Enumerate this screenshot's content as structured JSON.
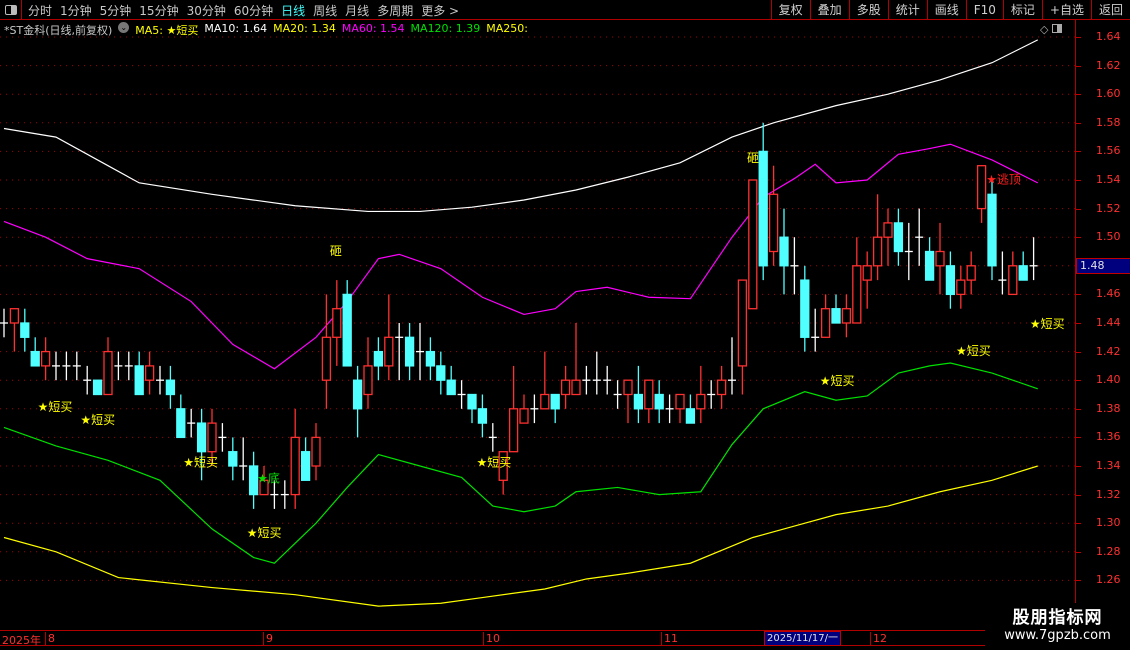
{
  "toolbar": {
    "periods": [
      "分时",
      "1分钟",
      "5分钟",
      "15分钟",
      "30分钟",
      "60分钟",
      "日线",
      "周线",
      "月线",
      "多周期",
      "更多 >"
    ],
    "active_period": "日线",
    "buttons": [
      "复权",
      "叠加",
      "多股",
      "统计",
      "画线",
      "F10",
      "标记",
      "+自选",
      "返回"
    ]
  },
  "info": {
    "stock": "*ST金科(日线,前复权)",
    "ma5_label": "MA5:",
    "ma5_value": "★短买",
    "ma10": "MA10: 1.64",
    "ma20": "MA20: 1.34",
    "ma60": "MA60: 1.54",
    "ma120": "MA120: 1.39",
    "ma250": "MA250:"
  },
  "colors": {
    "up": "#ff3030",
    "down": "#50ffff",
    "doji": "#ffffff",
    "ma_white": "#ffffff",
    "ma_magenta": "#ff00ff",
    "ma_green": "#00e000",
    "ma_yellow": "#ffff00",
    "grid": "#a00000"
  },
  "price_axis": {
    "labels": [
      "1.64",
      "1.62",
      "1.60",
      "1.58",
      "1.56",
      "1.54",
      "1.52",
      "1.50",
      "1.48",
      "1.46",
      "1.44",
      "1.42",
      "1.40",
      "1.38",
      "1.36",
      "1.34",
      "1.32",
      "1.30",
      "1.28",
      "1.26"
    ],
    "current": "1.48"
  },
  "date_axis": {
    "labels": [
      "2025年",
      "8",
      "9",
      "10",
      "11",
      "12"
    ],
    "cursor": "2025/11/17/一"
  },
  "watermark": {
    "line1": "股朋指标网",
    "line2": "www.7gpzb.com"
  },
  "chart_data": {
    "type": "candlestick",
    "ylim": [
      1.25,
      1.65
    ],
    "candles_ohlc": [
      [
        1.44,
        1.44,
        1.45,
        1.43
      ],
      [
        1.44,
        1.45,
        1.45,
        1.42
      ],
      [
        1.44,
        1.43,
        1.45,
        1.42
      ],
      [
        1.42,
        1.41,
        1.43,
        1.41
      ],
      [
        1.41,
        1.42,
        1.43,
        1.4
      ],
      [
        1.41,
        1.41,
        1.42,
        1.4
      ],
      [
        1.41,
        1.41,
        1.42,
        1.4
      ],
      [
        1.41,
        1.41,
        1.42,
        1.4
      ],
      [
        1.4,
        1.4,
        1.41,
        1.39
      ],
      [
        1.4,
        1.39,
        1.4,
        1.39
      ],
      [
        1.39,
        1.42,
        1.43,
        1.39
      ],
      [
        1.41,
        1.41,
        1.42,
        1.4
      ],
      [
        1.41,
        1.41,
        1.42,
        1.4
      ],
      [
        1.41,
        1.39,
        1.42,
        1.39
      ],
      [
        1.4,
        1.41,
        1.42,
        1.39
      ],
      [
        1.4,
        1.4,
        1.41,
        1.39
      ],
      [
        1.4,
        1.39,
        1.41,
        1.38
      ],
      [
        1.38,
        1.36,
        1.39,
        1.36
      ],
      [
        1.37,
        1.37,
        1.38,
        1.36
      ],
      [
        1.37,
        1.35,
        1.38,
        1.33
      ],
      [
        1.35,
        1.37,
        1.38,
        1.34
      ],
      [
        1.36,
        1.36,
        1.37,
        1.35
      ],
      [
        1.35,
        1.34,
        1.36,
        1.33
      ],
      [
        1.34,
        1.34,
        1.36,
        1.33
      ],
      [
        1.34,
        1.32,
        1.35,
        1.31
      ],
      [
        1.32,
        1.33,
        1.34,
        1.32
      ],
      [
        1.32,
        1.32,
        1.33,
        1.31
      ],
      [
        1.32,
        1.32,
        1.33,
        1.31
      ],
      [
        1.32,
        1.36,
        1.38,
        1.31
      ],
      [
        1.35,
        1.33,
        1.36,
        1.33
      ],
      [
        1.34,
        1.36,
        1.37,
        1.33
      ],
      [
        1.4,
        1.43,
        1.46,
        1.38
      ],
      [
        1.43,
        1.45,
        1.47,
        1.41
      ],
      [
        1.46,
        1.41,
        1.47,
        1.41
      ],
      [
        1.4,
        1.38,
        1.41,
        1.36
      ],
      [
        1.39,
        1.41,
        1.43,
        1.38
      ],
      [
        1.42,
        1.41,
        1.43,
        1.4
      ],
      [
        1.41,
        1.43,
        1.46,
        1.4
      ],
      [
        1.43,
        1.43,
        1.44,
        1.4
      ],
      [
        1.43,
        1.41,
        1.44,
        1.4
      ],
      [
        1.42,
        1.42,
        1.44,
        1.4
      ],
      [
        1.42,
        1.41,
        1.43,
        1.4
      ],
      [
        1.41,
        1.4,
        1.42,
        1.39
      ],
      [
        1.4,
        1.39,
        1.41,
        1.39
      ],
      [
        1.39,
        1.39,
        1.4,
        1.38
      ],
      [
        1.39,
        1.38,
        1.39,
        1.37
      ],
      [
        1.38,
        1.37,
        1.39,
        1.36
      ],
      [
        1.36,
        1.36,
        1.37,
        1.35
      ],
      [
        1.33,
        1.35,
        1.35,
        1.32
      ],
      [
        1.35,
        1.38,
        1.41,
        1.35
      ],
      [
        1.37,
        1.38,
        1.39,
        1.37
      ],
      [
        1.38,
        1.38,
        1.39,
        1.37
      ],
      [
        1.38,
        1.39,
        1.42,
        1.38
      ],
      [
        1.39,
        1.38,
        1.39,
        1.37
      ],
      [
        1.39,
        1.4,
        1.41,
        1.38
      ],
      [
        1.39,
        1.4,
        1.44,
        1.39
      ],
      [
        1.4,
        1.4,
        1.41,
        1.39
      ],
      [
        1.4,
        1.4,
        1.42,
        1.39
      ],
      [
        1.4,
        1.4,
        1.41,
        1.39
      ],
      [
        1.39,
        1.39,
        1.4,
        1.38
      ],
      [
        1.39,
        1.4,
        1.4,
        1.37
      ],
      [
        1.39,
        1.38,
        1.41,
        1.37
      ],
      [
        1.38,
        1.4,
        1.4,
        1.37
      ],
      [
        1.39,
        1.38,
        1.4,
        1.37
      ],
      [
        1.38,
        1.38,
        1.39,
        1.37
      ],
      [
        1.38,
        1.39,
        1.39,
        1.37
      ],
      [
        1.38,
        1.37,
        1.39,
        1.37
      ],
      [
        1.38,
        1.39,
        1.41,
        1.37
      ],
      [
        1.39,
        1.39,
        1.4,
        1.38
      ],
      [
        1.39,
        1.4,
        1.41,
        1.38
      ],
      [
        1.4,
        1.4,
        1.43,
        1.39
      ],
      [
        1.41,
        1.47,
        1.47,
        1.39
      ],
      [
        1.45,
        1.54,
        1.54,
        1.45
      ],
      [
        1.56,
        1.48,
        1.58,
        1.47
      ],
      [
        1.49,
        1.53,
        1.55,
        1.48
      ],
      [
        1.5,
        1.48,
        1.52,
        1.46
      ],
      [
        1.48,
        1.48,
        1.5,
        1.46
      ],
      [
        1.47,
        1.43,
        1.48,
        1.42
      ],
      [
        1.43,
        1.43,
        1.45,
        1.42
      ],
      [
        1.43,
        1.45,
        1.46,
        1.43
      ],
      [
        1.45,
        1.44,
        1.46,
        1.44
      ],
      [
        1.44,
        1.45,
        1.46,
        1.43
      ],
      [
        1.44,
        1.48,
        1.5,
        1.44
      ],
      [
        1.47,
        1.48,
        1.49,
        1.45
      ],
      [
        1.48,
        1.5,
        1.53,
        1.47
      ],
      [
        1.5,
        1.51,
        1.52,
        1.48
      ],
      [
        1.51,
        1.49,
        1.52,
        1.48
      ],
      [
        1.49,
        1.49,
        1.51,
        1.47
      ],
      [
        1.5,
        1.5,
        1.52,
        1.48
      ],
      [
        1.49,
        1.47,
        1.5,
        1.47
      ],
      [
        1.48,
        1.49,
        1.51,
        1.46
      ],
      [
        1.48,
        1.46,
        1.49,
        1.45
      ],
      [
        1.46,
        1.47,
        1.48,
        1.45
      ],
      [
        1.47,
        1.48,
        1.49,
        1.46
      ],
      [
        1.52,
        1.55,
        1.55,
        1.51
      ],
      [
        1.53,
        1.48,
        1.54,
        1.47
      ],
      [
        1.47,
        1.47,
        1.49,
        1.46
      ],
      [
        1.46,
        1.48,
        1.49,
        1.46
      ],
      [
        1.48,
        1.47,
        1.49,
        1.47
      ],
      [
        1.48,
        1.48,
        1.5,
        1.47
      ]
    ],
    "lines": [
      {
        "name": "white",
        "points": [
          [
            0,
            1.576
          ],
          [
            5,
            1.57
          ],
          [
            10,
            1.55
          ],
          [
            13,
            1.538
          ],
          [
            20,
            1.53
          ],
          [
            28,
            1.522
          ],
          [
            35,
            1.518
          ],
          [
            40,
            1.518
          ],
          [
            45,
            1.521
          ],
          [
            50,
            1.526
          ],
          [
            55,
            1.533
          ],
          [
            60,
            1.542
          ],
          [
            65,
            1.552
          ],
          [
            70,
            1.57
          ],
          [
            74,
            1.58
          ],
          [
            80,
            1.592
          ],
          [
            85,
            1.6
          ],
          [
            90,
            1.61
          ],
          [
            95,
            1.622
          ],
          [
            99.4,
            1.638
          ]
        ]
      },
      {
        "name": "magenta",
        "points": [
          [
            0,
            1.511
          ],
          [
            4,
            1.5
          ],
          [
            8,
            1.485
          ],
          [
            13,
            1.478
          ],
          [
            18,
            1.455
          ],
          [
            22,
            1.425
          ],
          [
            26,
            1.408
          ],
          [
            30,
            1.43
          ],
          [
            33,
            1.455
          ],
          [
            36,
            1.485
          ],
          [
            38,
            1.488
          ],
          [
            42,
            1.478
          ],
          [
            46,
            1.458
          ],
          [
            50,
            1.446
          ],
          [
            53,
            1.45
          ],
          [
            55,
            1.462
          ],
          [
            58,
            1.465
          ],
          [
            62,
            1.458
          ],
          [
            66,
            1.457
          ],
          [
            70,
            1.5
          ],
          [
            73,
            1.528
          ],
          [
            76,
            1.541
          ],
          [
            78,
            1.551
          ],
          [
            80,
            1.538
          ],
          [
            83,
            1.54
          ],
          [
            86,
            1.558
          ],
          [
            89,
            1.562
          ],
          [
            91,
            1.565
          ],
          [
            95,
            1.554
          ],
          [
            99.4,
            1.538
          ]
        ]
      },
      {
        "name": "green",
        "points": [
          [
            0,
            1.367
          ],
          [
            5,
            1.354
          ],
          [
            10,
            1.344
          ],
          [
            15,
            1.33
          ],
          [
            20,
            1.296
          ],
          [
            24,
            1.276
          ],
          [
            26,
            1.272
          ],
          [
            30,
            1.3
          ],
          [
            33,
            1.325
          ],
          [
            36,
            1.348
          ],
          [
            40,
            1.34
          ],
          [
            44,
            1.332
          ],
          [
            47,
            1.312
          ],
          [
            50,
            1.308
          ],
          [
            53,
            1.312
          ],
          [
            55,
            1.322
          ],
          [
            59,
            1.325
          ],
          [
            63,
            1.32
          ],
          [
            67,
            1.322
          ],
          [
            70,
            1.355
          ],
          [
            73,
            1.38
          ],
          [
            77,
            1.392
          ],
          [
            80,
            1.386
          ],
          [
            83,
            1.389
          ],
          [
            86,
            1.405
          ],
          [
            89,
            1.41
          ],
          [
            91,
            1.412
          ],
          [
            95,
            1.405
          ],
          [
            99.4,
            1.394
          ]
        ]
      },
      {
        "name": "yellow",
        "points": [
          [
            0,
            1.29
          ],
          [
            5,
            1.28
          ],
          [
            11,
            1.262
          ],
          [
            20,
            1.255
          ],
          [
            28,
            1.25
          ],
          [
            36,
            1.242
          ],
          [
            42,
            1.244
          ],
          [
            46,
            1.248
          ],
          [
            52,
            1.254
          ],
          [
            56,
            1.261
          ],
          [
            60,
            1.265
          ],
          [
            66,
            1.272
          ],
          [
            72,
            1.29
          ],
          [
            76,
            1.298
          ],
          [
            80,
            1.306
          ],
          [
            85,
            1.312
          ],
          [
            90,
            1.322
          ],
          [
            95,
            1.33
          ],
          [
            99.4,
            1.34
          ]
        ]
      }
    ],
    "signals": [
      {
        "label": "★短买",
        "kind": "buy",
        "index": 4.2,
        "price": 1.382
      },
      {
        "label": "★短买",
        "kind": "buy",
        "index": 8.3,
        "price": 1.373
      },
      {
        "label": "★短买",
        "kind": "buy",
        "index": 18.2,
        "price": 1.343
      },
      {
        "label": "★短买",
        "kind": "buy",
        "index": 24.3,
        "price": 1.294
      },
      {
        "label": "★短买",
        "kind": "buy",
        "index": 46.4,
        "price": 1.343
      },
      {
        "label": "★短买",
        "kind": "buy",
        "index": 79.4,
        "price": 1.4
      },
      {
        "label": "★短买",
        "kind": "buy",
        "index": 92.5,
        "price": 1.421
      },
      {
        "label": "★短买",
        "kind": "buy",
        "index": 99.6,
        "price": 1.44
      },
      {
        "label": "★逃顶",
        "kind": "top",
        "index": 95.4,
        "price": 1.541
      },
      {
        "label": "★底",
        "kind": "bottom",
        "index": 25.3,
        "price": 1.332
      },
      {
        "label": "砸",
        "kind": "mark",
        "index": 32.3,
        "price": 1.491
      },
      {
        "label": "砸",
        "kind": "mark",
        "index": 72.4,
        "price": 1.556
      }
    ]
  }
}
